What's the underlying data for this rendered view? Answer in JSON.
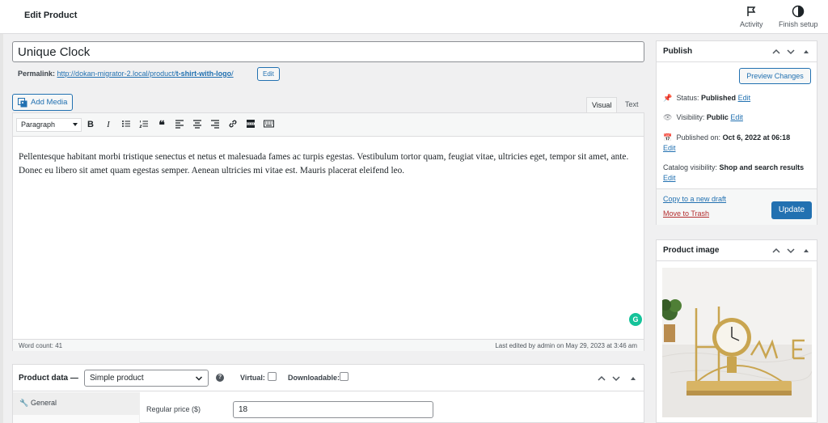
{
  "topbar": {
    "title": "Edit Product",
    "activity_label": "Activity",
    "finish_setup_label": "Finish setup"
  },
  "editor": {
    "title_value": "Unique Clock",
    "permalink_label": "Permalink:",
    "permalink_url": "http://dokan-migrator-2.local/product/",
    "permalink_slug": "t-shirt-with-logo",
    "permalink_trailing": "/",
    "permalink_edit": "Edit",
    "add_media_label": "Add Media",
    "tab_visual": "Visual",
    "tab_text": "Text",
    "format_select": "Paragraph",
    "content": "Pellentesque habitant morbi tristique senectus et netus et malesuada fames ac turpis egestas. Vestibulum tortor quam, feugiat vitae, ultricies eget, tempor sit amet, ante. Donec eu libero sit amet quam egestas semper. Aenean ultricies mi vitae est. Mauris placerat eleifend leo.",
    "word_count": "Word count: 41",
    "last_edited": "Last edited by admin on May 29, 2023 at 3:46 am",
    "grammarly_badge": "G"
  },
  "product_data": {
    "title": "Product data —",
    "type_value": "Simple product",
    "help_icon": "?",
    "virtual_label": "Virtual:",
    "downloadable_label": "Downloadable:",
    "tab_general": "General",
    "regular_price_label": "Regular price ($)",
    "regular_price_value": "18"
  },
  "publish": {
    "title": "Publish",
    "preview_label": "Preview Changes",
    "status_label": "Status:",
    "status_value": "Published",
    "visibility_label": "Visibility:",
    "visibility_value": "Public",
    "published_label": "Published on:",
    "published_value": "Oct 6, 2022 at 06:18",
    "catalog_label": "Catalog visibility:",
    "catalog_value": "Shop and search results",
    "edit_label": "Edit",
    "copy_draft": "Copy to a new draft",
    "move_trash": "Move to Trash",
    "update_label": "Update"
  },
  "product_image": {
    "title": "Product image"
  },
  "colors": {
    "primary": "#2271b1",
    "danger": "#b32d2e",
    "grammarly": "#15c39a"
  }
}
